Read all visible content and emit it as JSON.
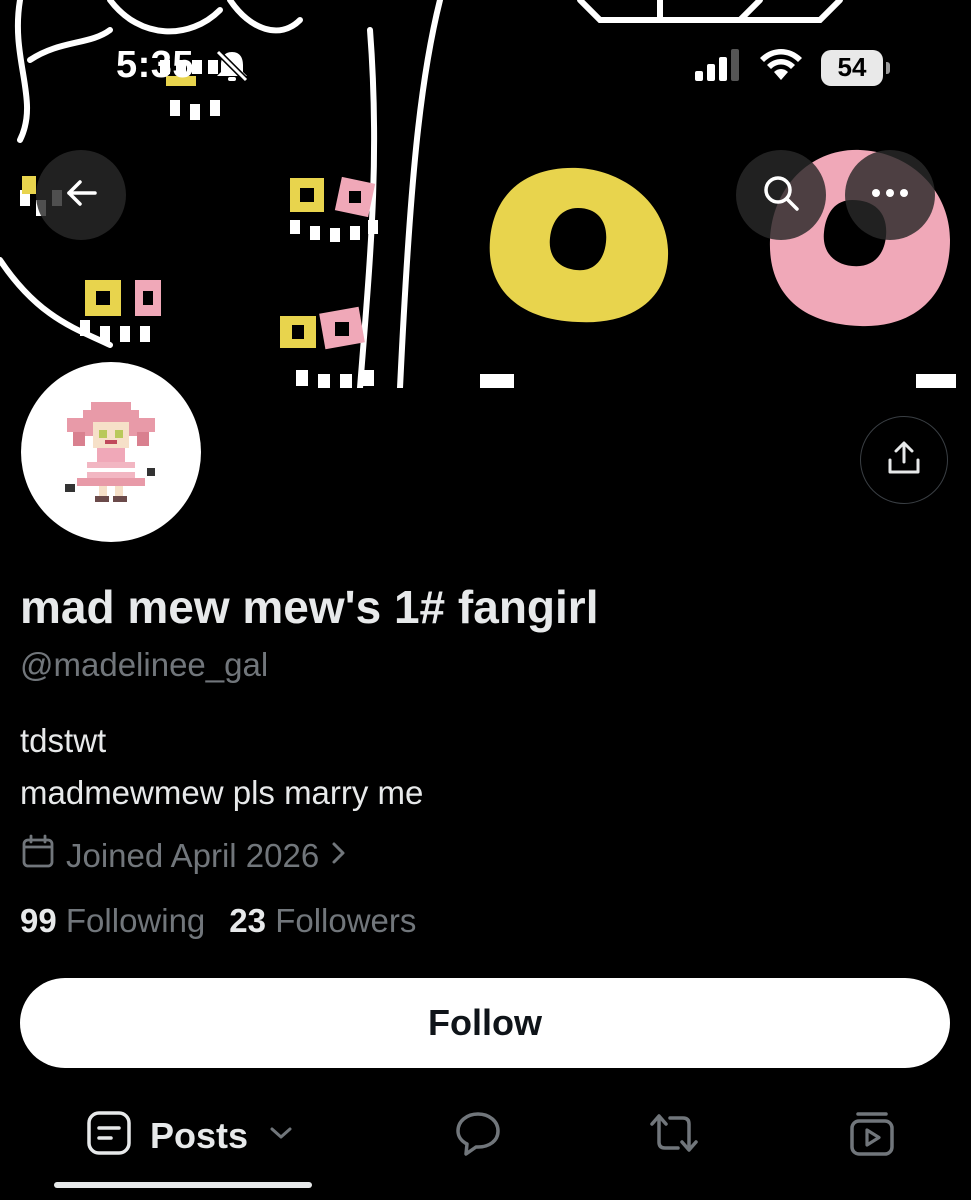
{
  "status_bar": {
    "time": "5:35",
    "battery": "54",
    "icons": [
      "mute-bell-icon",
      "cellular-signal-icon",
      "wifi-icon",
      "battery-icon"
    ]
  },
  "header": {
    "back_icon": "arrow-left-icon",
    "search_icon": "search-icon",
    "more_icon": "more-horizontal-icon"
  },
  "profile": {
    "display_name": "mad mew mew's 1# fangirl",
    "handle": "@madelinee_gal",
    "bio": [
      "tdstwt",
      "madmewmew pls marry me"
    ],
    "joined": "Joined April 2026",
    "following_count": "99",
    "following_label": "Following",
    "followers_count": "23",
    "followers_label": "Followers",
    "share_icon": "share-icon"
  },
  "actions": {
    "follow_label": "Follow"
  },
  "tabs": {
    "posts_label": "Posts",
    "items": [
      "posts-tab",
      "replies-tab",
      "reposts-tab",
      "media-tab"
    ]
  },
  "colors": {
    "background": "#000000",
    "primary_text": "#e7e9ea",
    "secondary_text": "#71767b",
    "banner_yellow": "#e8d44d",
    "banner_pink": "#f0a8b8"
  }
}
